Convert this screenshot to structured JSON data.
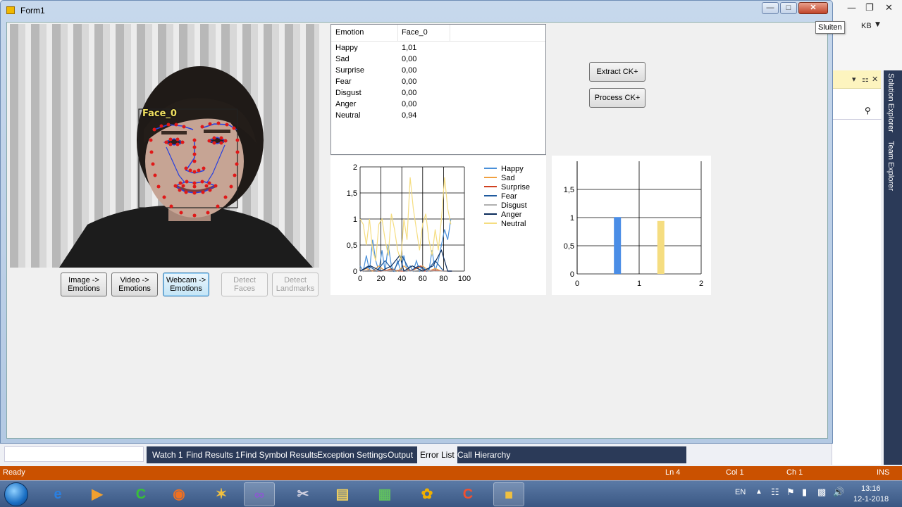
{
  "app": {
    "title": "Form1",
    "tooltip": "Sluiten"
  },
  "buttons": {
    "image_emotions": "Image -> Emotions",
    "video_emotions": "Video -> Emotions",
    "webcam_emotions": "Webcam -> Emotions",
    "detect_faces": "Detect Faces",
    "detect_landmarks": "Detect Landmarks",
    "extract_ck": "Extract CK+",
    "process_ck": "Process CK+"
  },
  "photo": {
    "face_label": "Face_0"
  },
  "table": {
    "headers": [
      "Emotion",
      "Face_0"
    ],
    "rows": [
      {
        "emotion": "Happy",
        "value": "1,01"
      },
      {
        "emotion": "Sad",
        "value": "0,00"
      },
      {
        "emotion": "Surprise",
        "value": "0,00"
      },
      {
        "emotion": "Fear",
        "value": "0,00"
      },
      {
        "emotion": "Disgust",
        "value": "0,00"
      },
      {
        "emotion": "Anger",
        "value": "0,00"
      },
      {
        "emotion": "Neutral",
        "value": "0,94"
      }
    ]
  },
  "chart_data": [
    {
      "type": "line",
      "title": "",
      "xlabel": "",
      "ylabel": "",
      "xlim": [
        0,
        100
      ],
      "ylim": [
        0,
        2
      ],
      "xticks": [
        "0",
        "20",
        "40",
        "60",
        "80",
        "100"
      ],
      "yticks": [
        "0",
        "0,5",
        "1",
        "1,5",
        "2"
      ],
      "grid": true,
      "legend_position": "right",
      "series": [
        {
          "name": "Happy",
          "color": "#4a90d9",
          "x": [
            0,
            3,
            6,
            9,
            12,
            15,
            18,
            21,
            24,
            27,
            30,
            33,
            36,
            39,
            42,
            45,
            48,
            51,
            54,
            57,
            60,
            63,
            66,
            69,
            72,
            75,
            78,
            81,
            84,
            87
          ],
          "y": [
            0.1,
            0.0,
            0.3,
            0.0,
            0.6,
            0.2,
            0.0,
            0.4,
            0.0,
            0.5,
            0.1,
            0.0,
            0.2,
            0.0,
            0.3,
            0.0,
            0.1,
            0.0,
            0.2,
            0.0,
            0.1,
            0.0,
            0.0,
            0.4,
            0.0,
            0.2,
            0.5,
            0.8,
            0.6,
            1.0
          ]
        },
        {
          "name": "Sad",
          "color": "#f0a040",
          "x": [
            0,
            6,
            12,
            18,
            24,
            30,
            36,
            42,
            48,
            54,
            60,
            66,
            72,
            78,
            84
          ],
          "y": [
            0.0,
            0.05,
            0.0,
            0.1,
            0.0,
            0.05,
            0.0,
            0.1,
            0.0,
            0.05,
            0.1,
            0.0,
            0.05,
            0.0,
            0.0
          ]
        },
        {
          "name": "Surprise",
          "color": "#d04020",
          "x": [
            0,
            10,
            20,
            30,
            40,
            50,
            58,
            62,
            70,
            80,
            88
          ],
          "y": [
            0.0,
            0.02,
            0.0,
            0.03,
            0.0,
            0.02,
            0.1,
            0.0,
            0.02,
            0.0,
            0.0
          ]
        },
        {
          "name": "Fear",
          "color": "#1f5a9e",
          "x": [
            0,
            8,
            16,
            24,
            32,
            40,
            48,
            56,
            64,
            72,
            80,
            88
          ],
          "y": [
            0.0,
            0.1,
            0.0,
            0.2,
            0.0,
            0.3,
            0.0,
            0.1,
            0.0,
            0.2,
            0.0,
            0.0
          ]
        },
        {
          "name": "Disgust",
          "color": "#b0b0b0",
          "x": [
            0,
            12,
            24,
            36,
            48,
            60,
            72,
            84
          ],
          "y": [
            0.0,
            0.02,
            0.0,
            0.02,
            0.0,
            0.02,
            0.0,
            0.0
          ]
        },
        {
          "name": "Anger",
          "color": "#0a2a5a",
          "x": [
            0,
            10,
            20,
            30,
            38,
            42,
            50,
            60,
            70,
            78,
            84,
            88
          ],
          "y": [
            0.0,
            0.1,
            0.0,
            0.1,
            0.3,
            0.0,
            0.1,
            0.0,
            0.1,
            0.4,
            0.0,
            0.0
          ]
        },
        {
          "name": "Neutral",
          "color": "#f5dd80",
          "x": [
            0,
            3,
            6,
            9,
            12,
            15,
            18,
            21,
            24,
            27,
            30,
            33,
            36,
            39,
            42,
            45,
            48,
            51,
            54,
            57,
            60,
            63,
            66,
            69,
            72,
            75,
            78,
            81,
            84,
            87
          ],
          "y": [
            1.0,
            0.9,
            0.5,
            1.0,
            0.4,
            0.2,
            0.9,
            1.0,
            0.6,
            0.3,
            1.1,
            0.8,
            0.4,
            0.2,
            1.0,
            0.6,
            1.8,
            1.2,
            0.8,
            0.4,
            0.9,
            1.1,
            0.6,
            0.3,
            0.8,
            0.4,
            1.0,
            1.8,
            1.2,
            0.9
          ]
        }
      ]
    },
    {
      "type": "bar",
      "title": "",
      "xlabel": "",
      "ylabel": "",
      "xlim": [
        0,
        2
      ],
      "ylim": [
        0,
        2
      ],
      "xticks": [
        "0",
        "1",
        "2"
      ],
      "yticks": [
        "0",
        "0,5",
        "1",
        "1,5"
      ],
      "grid": true,
      "series": [
        {
          "x": 0.65,
          "value": 1.01,
          "color": "#4a8de6"
        },
        {
          "x": 1.35,
          "value": 0.94,
          "color": "#f5dd80"
        }
      ]
    }
  ],
  "vs": {
    "user": "KB",
    "side_tabs": [
      "Solution Explorer",
      "Team Explorer"
    ],
    "bottom_tabs": [
      "Watch 1",
      "Find Results 1",
      "Find Symbol Results",
      "Exception Settings",
      "Output",
      "Error List",
      "Call Hierarchy"
    ],
    "active_tab": "Error List",
    "status": {
      "ready": "Ready",
      "line": "Ln 4",
      "col": "Col 1",
      "ch": "Ch 1",
      "ins": "INS"
    }
  },
  "taskbar": {
    "lang": "EN",
    "time": "13:16",
    "date": "12-1-2018"
  }
}
